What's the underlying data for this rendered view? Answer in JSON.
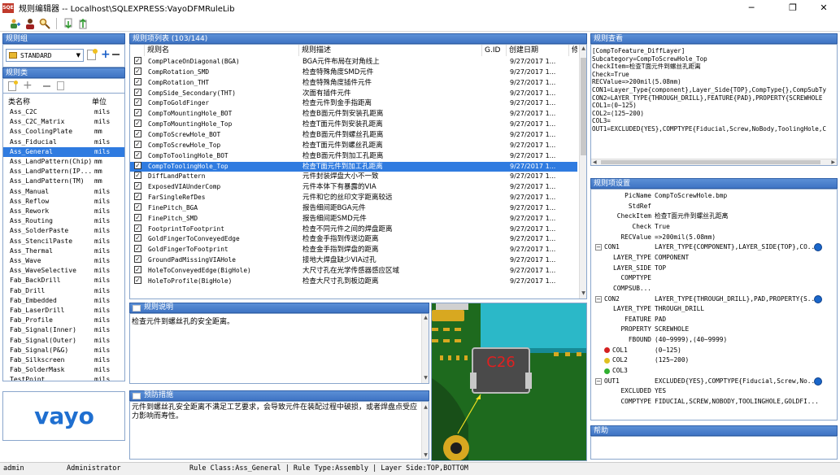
{
  "window": {
    "title": "规则编辑器  --  Localhost\\SQLEXPRESS:VayoDFMRuleLib",
    "app_icon": "SQE",
    "minimize_icon": "─",
    "maximize_icon": "❐",
    "close_icon": "✕"
  },
  "toolbar": {
    "icons": [
      "users-add-icon",
      "user-icon",
      "search-icon",
      "import-icon",
      "export-icon"
    ]
  },
  "rule_group": {
    "header": "规则组",
    "selected": "STANDARD"
  },
  "rule_class": {
    "header": "规则类",
    "col_name": "类名称",
    "col_unit": "单位",
    "items": [
      {
        "name": "Ass_C2C",
        "unit": "mils"
      },
      {
        "name": "Ass_C2C_Matrix",
        "unit": "mils"
      },
      {
        "name": "Ass_CoolingPlate",
        "unit": "mm"
      },
      {
        "name": "Ass_Fiducial",
        "unit": "mils"
      },
      {
        "name": "Ass_General",
        "unit": "mils"
      },
      {
        "name": "Ass_LandPattern(Chip)",
        "unit": "mm"
      },
      {
        "name": "Ass_LandPattern(IP...",
        "unit": "mm"
      },
      {
        "name": "Ass_LandPattern(TM)",
        "unit": "mm"
      },
      {
        "name": "Ass_Manual",
        "unit": "mils"
      },
      {
        "name": "Ass_Reflow",
        "unit": "mils"
      },
      {
        "name": "Ass_Rework",
        "unit": "mils"
      },
      {
        "name": "Ass_Routing",
        "unit": "mils"
      },
      {
        "name": "Ass_SolderPaste",
        "unit": "mils"
      },
      {
        "name": "Ass_StencilPaste",
        "unit": "mils"
      },
      {
        "name": "Ass_Thermal",
        "unit": "mils"
      },
      {
        "name": "Ass_Wave",
        "unit": "mils"
      },
      {
        "name": "Ass_WaveSelective",
        "unit": "mils"
      },
      {
        "name": "Fab_BackDrill",
        "unit": "mils"
      },
      {
        "name": "Fab_Drill",
        "unit": "mils"
      },
      {
        "name": "Fab_Embedded",
        "unit": "mils"
      },
      {
        "name": "Fab_LaserDrill",
        "unit": "mils"
      },
      {
        "name": "Fab_Profile",
        "unit": "mils"
      },
      {
        "name": "Fab_Signal(Inner)",
        "unit": "mils"
      },
      {
        "name": "Fab_Signal(Outer)",
        "unit": "mils"
      },
      {
        "name": "Fab_Signal(P&G)",
        "unit": "mils"
      },
      {
        "name": "Fab_Silkscreen",
        "unit": "mils"
      },
      {
        "name": "Fab_SolderMask",
        "unit": "mils"
      },
      {
        "name": "TestPoint",
        "unit": "mils"
      }
    ],
    "selected_index": 4
  },
  "logo": "vayo",
  "rule_list": {
    "header": "规则项列表 (103/144)",
    "col_name": "规则名",
    "col_desc": "规则描述",
    "col_gid": "G.ID",
    "col_date": "创建日期",
    "col_extra": "修",
    "selected_index": 10,
    "rows": [
      {
        "name": "CompPlaceOnDiagonal(BGA)",
        "desc": "BGA元件布局在对角线上",
        "date": "9/27/2017 1..."
      },
      {
        "name": "CompRotation_SMD",
        "desc": "检查特殊角度SMD元件",
        "date": "9/27/2017 1..."
      },
      {
        "name": "CompRotation_THT",
        "desc": "检查特殊角度插件元件",
        "date": "9/27/2017 1..."
      },
      {
        "name": "CompSide_Secondary(THT)",
        "desc": "次面有插件元件",
        "date": "9/27/2017 1..."
      },
      {
        "name": "CompToGoldFinger",
        "desc": "检查元件到金手指距离",
        "date": "9/27/2017 1..."
      },
      {
        "name": "CompToMountingHole_BOT",
        "desc": "检查B面元件到安装孔距离",
        "date": "9/27/2017 1..."
      },
      {
        "name": "CompToMountingHole_Top",
        "desc": "检查T面元件到安装孔距离",
        "date": "9/27/2017 1..."
      },
      {
        "name": "CompToScrewHole_BOT",
        "desc": "检查B面元件到螺丝孔距离",
        "date": "9/27/2017 1..."
      },
      {
        "name": "CompToScrewHole_Top",
        "desc": "检查T面元件到螺丝孔距离",
        "date": "9/27/2017 1..."
      },
      {
        "name": "CompToToolingHole_BOT",
        "desc": "检查B面元件到加工孔距离",
        "date": "9/27/2017 1..."
      },
      {
        "name": "CompToToolingHole_Top",
        "desc": "检查T面元件到加工孔距离",
        "date": "9/27/2017 1..."
      },
      {
        "name": "DiffLandPattern",
        "desc": "元件封装焊盘大小不一致",
        "date": "9/27/2017 1..."
      },
      {
        "name": "ExposedVIAUnderComp",
        "desc": "元件本体下有暴露的VIA",
        "date": "9/27/2017 1..."
      },
      {
        "name": "FarSingleRefDes",
        "desc": "元件和它的丝印文字距离较远",
        "date": "9/27/2017 1..."
      },
      {
        "name": "FinePitch_BGA",
        "desc": "报告细间距BGA元件",
        "date": "9/27/2017 1..."
      },
      {
        "name": "FinePitch_SMD",
        "desc": "报告细间距SMD元件",
        "date": "9/27/2017 1..."
      },
      {
        "name": "FootprintToFootprint",
        "desc": "检查不同元件之间的焊盘距离",
        "date": "9/27/2017 1..."
      },
      {
        "name": "GoldFingerToConveyedEdge",
        "desc": "检查金手指到传送边距离",
        "date": "9/27/2017 1..."
      },
      {
        "name": "GoldFingerToFootprint",
        "desc": "检查金手指到焊盘的距离",
        "date": "9/27/2017 1..."
      },
      {
        "name": "GroundPadMissingVIAHole",
        "desc": "接地大焊盘缺少VIA过孔",
        "date": "9/27/2017 1..."
      },
      {
        "name": "HoleToConveyedEdge(BigHole)",
        "desc": "大尺寸孔在光学传感器感应区域",
        "date": "9/27/2017 1..."
      },
      {
        "name": "HoleToProfile(BigHole)",
        "desc": "检查大尺寸孔到板边距离",
        "date": "9/27/2017 1..."
      }
    ]
  },
  "rule_explain": {
    "header": "规则说明",
    "text": "检查元件到螺丝孔的安全距离。"
  },
  "rule_prevent": {
    "header": "预防措施",
    "text": "元件到螺丝孔安全距离不满足工艺要求，会导致元件在装配过程中破损，或者焊盘点受应力影响而寿性。"
  },
  "preview": {
    "label": "C26"
  },
  "rule_view": {
    "header": "规则查看",
    "lines": [
      "[CompToFeature_DiffLayer]",
      "Subcategory=CompToScrewHole_Top",
      "CheckItem=检查T面元件到螺丝孔距离",
      "Check=True",
      "RECValue=>200mil(5.08mm)",
      "CON1=Layer_Type{component},Layer_Side{TOP},CompType{},CompSubTy",
      "CON2=LAYER_TYPE{THROUGH_DRILL},FEATURE{PAD},PROPERTY{SCREWHOLE",
      "COL1=(0~125)",
      "COL2=(125~200)",
      "COL3=",
      "OUT1=EXCLUDED{YES},COMPTYPE{Fiducial,Screw,NoBody,ToolingHole,C"
    ]
  },
  "rule_settings": {
    "header": "规则项设置",
    "rows": [
      {
        "k": "PicName",
        "v": "CompToScrewHole.bmp",
        "indent": 0
      },
      {
        "k": "StdRef",
        "v": "",
        "indent": 0
      },
      {
        "k": "CheckItem",
        "v": "检查T面元件到螺丝孔距离",
        "indent": 0
      },
      {
        "k": "Check",
        "v": "True",
        "indent": 0
      },
      {
        "k": "RECValue",
        "v": "=>200mil(5.08mm)",
        "indent": 0
      },
      {
        "k": "CON1",
        "v": "LAYER_TYPE{COMPONENT},LAYER_SIDE{TOP},CO...",
        "indent": -1,
        "expand": true,
        "btn": true
      },
      {
        "k": "LAYER_TYPE",
        "v": "COMPONENT",
        "indent": 1
      },
      {
        "k": "LAYER_SIDE",
        "v": "TOP",
        "indent": 1
      },
      {
        "k": "COMPTYPE",
        "v": "",
        "indent": 1
      },
      {
        "k": "COMPSUB...",
        "v": "",
        "indent": 1
      },
      {
        "k": "CON2",
        "v": "LAYER_TYPE{THROUGH_DRILL},PAD,PROPERTY{S...",
        "indent": -1,
        "expand": true,
        "btn": true
      },
      {
        "k": "LAYER_TYPE",
        "v": "THROUGH_DRILL",
        "indent": 1
      },
      {
        "k": "FEATURE",
        "v": "PAD",
        "indent": 1
      },
      {
        "k": "PROPERTY",
        "v": "SCREWHOLE",
        "indent": 1
      },
      {
        "k": "FBOUND",
        "v": "(40~9999),(40~9999)",
        "indent": 1
      },
      {
        "k": "COL1",
        "v": "(0~125)",
        "indent": -1,
        "dot": "#d42020"
      },
      {
        "k": "COL2",
        "v": "(125~200)",
        "indent": -1,
        "dot": "#e0c020"
      },
      {
        "k": "COL3",
        "v": "",
        "indent": -1,
        "dot": "#30b030"
      },
      {
        "k": "OUT1",
        "v": "EXCLUDED{YES},COMPTYPE{Fiducial,Screw,No...",
        "indent": -1,
        "expand": true,
        "btn": true
      },
      {
        "k": "EXCLUDED",
        "v": "YES",
        "indent": 1
      },
      {
        "k": "COMPTYPE",
        "v": "FIDUCIAL,SCREW,NOBODY,TOOLINGHOLE,GOLDFI...",
        "indent": 1
      }
    ]
  },
  "help": {
    "header": "帮助"
  },
  "status": {
    "user": "admin",
    "role": "Administrator",
    "info": "Rule Class:Ass_General | Rule Type:Assembly | Layer Side:TOP,BOTTOM"
  }
}
